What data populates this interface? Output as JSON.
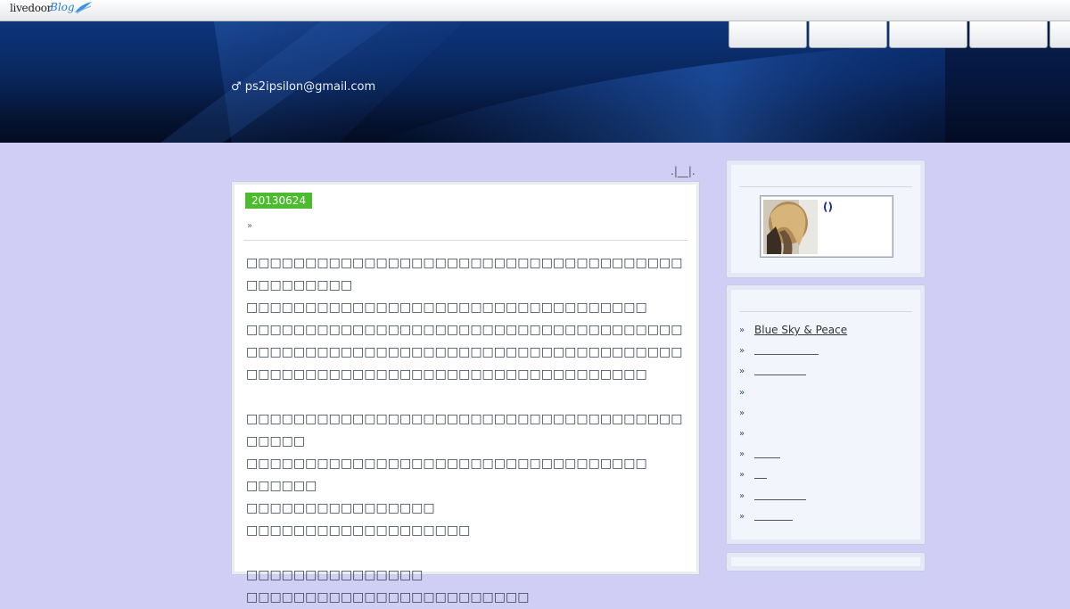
{
  "topbar": {
    "brand": "livedoor",
    "brand_suffix": "Blog"
  },
  "header": {
    "email": "♂ ps2ipsilon@gmail.com",
    "nav_tab_count": 5
  },
  "mini_nav": ".|__|.",
  "entry": {
    "date": "20130624",
    "arrow": "»",
    "paragraphs": [
      "□□□□□□□□□□□□□□□□□□□□□□□□□□□□□□□□□□□□□□□□□□□□□□",
      "□□□□□□□□□□□□□□□□□□□□□□□□□□□□□□□□□□",
      "□□□□□□□□□□□□□□□□□□□□□□□□□□□□□□□□□□□□□□□□□□□□□□□□□□□□□□□□□□□□□□□□□□□□□□□□□□□□□□□□□□□□□□□□□□□□□□□□□□□□□□□□□□□□",
      "",
      "□□□□□□□□□□□□□□□□□□□□□□□□□□□□□□□□□□□□□□□□□□",
      "□□□□□□□□□□□□□□□□□□□□□□□□□□□□□□□□□□",
      "□□□□□□",
      "□□□□□□□□□□□□□□□□",
      "□□□□□□□□□□□□□□□□□□□",
      "",
      "□□□□□□□□□□□□□□□",
      "□□□□□□□□□□□□□□□□□□□□□□□□"
    ]
  },
  "sidebar": {
    "profile": {
      "name": "()"
    },
    "links": [
      {
        "label": "Blue Sky & Peace",
        "kind": "text"
      },
      {
        "label": "",
        "kind": "line",
        "width": 72
      },
      {
        "label": "",
        "kind": "line",
        "width": 58
      },
      {
        "label": "",
        "kind": "empty"
      },
      {
        "label": "",
        "kind": "empty"
      },
      {
        "label": "",
        "kind": "empty"
      },
      {
        "label": "",
        "kind": "line",
        "width": 29
      },
      {
        "label": "",
        "kind": "line",
        "width": 14
      },
      {
        "label": "",
        "kind": "line",
        "width": 58
      },
      {
        "label": "",
        "kind": "line",
        "width": 43
      }
    ],
    "bullet": "»"
  },
  "colors": {
    "page_bg": "#d0cef4",
    "date_badge": "#4bbc2d",
    "header_dark": "#061637",
    "profile_name": "#1a2f8a"
  }
}
